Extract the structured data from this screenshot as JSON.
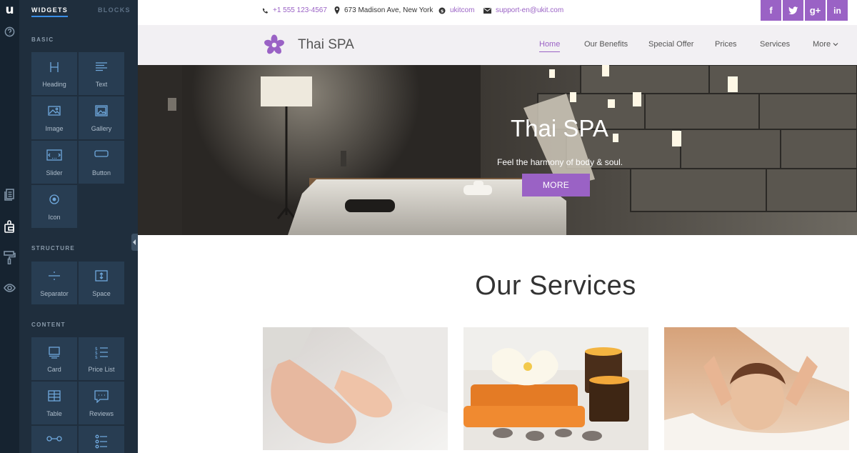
{
  "editor": {
    "logo": "u",
    "tabs": {
      "widgets": "WIDGETS",
      "blocks": "BLOCKS"
    },
    "sections": {
      "basic": "BASIC",
      "structure": "STRUCTURE",
      "content": "CONTENT"
    },
    "widgets": {
      "heading": "Heading",
      "text": "Text",
      "image": "Image",
      "gallery": "Gallery",
      "slider": "Slider",
      "button": "Button",
      "icon": "Icon",
      "separator": "Separator",
      "space": "Space",
      "card": "Card",
      "price_list": "Price List",
      "table": "Table",
      "reviews": "Reviews"
    },
    "accent_color": "#3a8ee6"
  },
  "site": {
    "topbar": {
      "phone": "+1 555 123-4567",
      "address": "673 Madison Ave, New York",
      "skype": "ukitcom",
      "email": "support-en@ukit.com",
      "social": {
        "facebook": "f",
        "twitter": "t",
        "google": "g+",
        "linkedin": "in"
      }
    },
    "brand": "Thai SPA",
    "nav": {
      "home": "Home",
      "benefits": "Our Benefits",
      "offer": "Special Offer",
      "prices": "Prices",
      "services": "Services",
      "more": "More"
    },
    "hero": {
      "title": "Thai SPA",
      "subtitle": "Feel the harmony of body & soul.",
      "button": "MORE"
    },
    "services_title": "Our Services",
    "accent_color": "#9a62c5"
  }
}
